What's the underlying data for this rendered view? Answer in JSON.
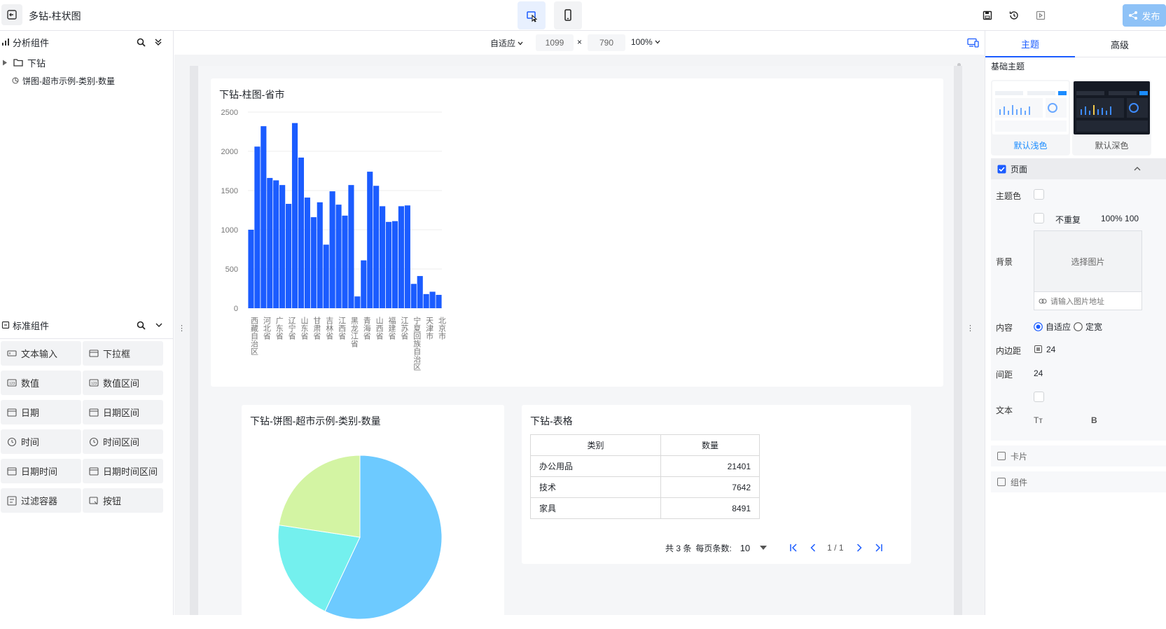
{
  "app": {
    "title": "多钻-柱状图",
    "publish_label": "发布"
  },
  "left_panel": {
    "analysis_header": "分析组件",
    "folder_label": "下钻",
    "item_label": "饼图-超市示例-类别-数量",
    "standard_header": "标准组件",
    "components": [
      "文本输入",
      "下拉框",
      "数值",
      "数值区间",
      "日期",
      "日期区间",
      "时间",
      "时间区间",
      "日期时间",
      "日期时间区间",
      "过滤容器",
      "按钮"
    ]
  },
  "toolbar": {
    "fit_label": "自适应",
    "width": "1099",
    "height": "790",
    "times": "×",
    "zoom": "100%"
  },
  "bar_card": {
    "title": "下钻-柱图-省市"
  },
  "pie_card": {
    "title": "下钻-饼图-超市示例-类别-数量"
  },
  "table_card": {
    "title": "下钻-表格",
    "headers": [
      "类别",
      "数量"
    ],
    "rows": [
      [
        "办公用品",
        "21401"
      ],
      [
        "技术",
        "7642"
      ],
      [
        "家具",
        "8491"
      ]
    ],
    "pagination": {
      "total": "共 3 条",
      "page_size_label": "每页条数:",
      "page_size": "10",
      "page": "1 / 1"
    }
  },
  "right_panel": {
    "tab_theme": "主题",
    "tab_advanced": "高级",
    "base_theme_label": "基础主题",
    "theme_light": "默认浅色",
    "theme_dark": "默认深色",
    "page_section": "页面",
    "theme_color_label": "主题色",
    "no_repeat": "不重复",
    "size_value": "100% 100",
    "bg_label": "背景",
    "select_image": "选择图片",
    "image_url_placeholder": "请输入图片地址",
    "content_label": "内容",
    "content_auto": "自适应",
    "content_fixed": "定宽",
    "padding_label": "内边距",
    "padding_value": "24",
    "gap_label": "间距",
    "gap_value": "24",
    "text_label": "文本",
    "text_tt": "Tт",
    "text_b": "B",
    "card_section": "卡片",
    "component_section": "组件"
  },
  "colors": {
    "accent": "#1b5cff",
    "bar": "#1b5cff",
    "pie": [
      "#6dcaff",
      "#74f0ee",
      "#d3f4a3"
    ]
  },
  "chart_data": {
    "type": "bar",
    "title": "下钻-柱图-省市",
    "ylim": [
      0,
      2500
    ],
    "yticks": [
      0,
      500,
      1000,
      1500,
      2000,
      2500
    ],
    "categories": [
      "西藏自治区",
      "",
      "河北省",
      "",
      "广东省",
      "",
      "辽宁省",
      "",
      "山东省",
      "",
      "甘肃省",
      "",
      "吉林省",
      "",
      "江西省",
      "",
      "黑龙江省",
      "",
      "青海省",
      "",
      "山西省",
      "",
      "福建省",
      "",
      "江苏省",
      "",
      "宁夏回族自治区",
      "",
      "天津市",
      "",
      "北京市"
    ],
    "values": [
      1000,
      2060,
      2320,
      1660,
      1630,
      1570,
      1330,
      2360,
      1920,
      1410,
      1160,
      1350,
      810,
      1490,
      1320,
      1180,
      1570,
      150,
      610,
      1740,
      1560,
      1300,
      1100,
      1110,
      1300,
      1310,
      310,
      410,
      180,
      210,
      170
    ]
  },
  "pie_data": {
    "type": "pie",
    "categories": [
      "办公用品",
      "技术",
      "家具"
    ],
    "values": [
      21401,
      7642,
      8491
    ]
  }
}
